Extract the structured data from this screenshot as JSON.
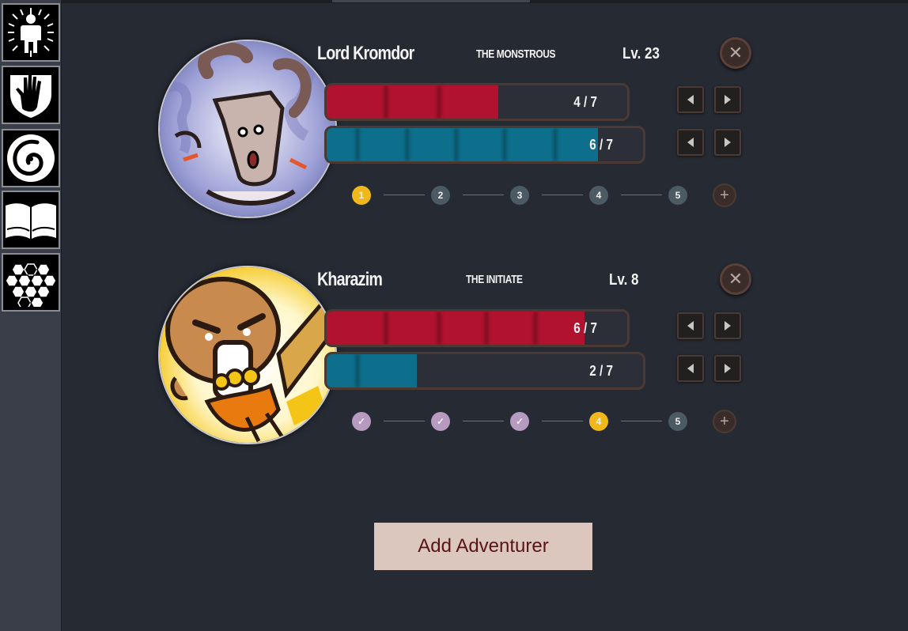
{
  "sidebar": {
    "items": [
      {
        "icon": "radiant-figure-icon"
      },
      {
        "icon": "hand-shield-icon"
      },
      {
        "icon": "spiral-icon"
      },
      {
        "icon": "open-book-icon"
      },
      {
        "icon": "hexagon-grid-icon"
      }
    ]
  },
  "adventurers": [
    {
      "name": "Lord Kromdor",
      "title": "THE MONSTROUS",
      "level": "Lv. 23",
      "health": {
        "text": "4 / 7",
        "current": 4,
        "max": 7
      },
      "mana": {
        "text": "6 / 7",
        "current": 6,
        "max": 7
      },
      "steps": [
        "1",
        "2",
        "3",
        "4",
        "5"
      ],
      "current_step": 1,
      "close_label": "✕",
      "add_step_label": "+"
    },
    {
      "name": "Kharazim",
      "title": "THE INITIATE",
      "level": "Lv. 8",
      "health": {
        "text": "6 / 7",
        "current": 6,
        "max": 7
      },
      "mana": {
        "text": "2 / 7",
        "current": 2,
        "max": 7
      },
      "steps": [
        "✓",
        "✓",
        "✓",
        "4",
        "5"
      ],
      "current_step": 4,
      "close_label": "✕",
      "add_step_label": "+"
    }
  ],
  "add_button_label": "Add Adventurer",
  "colors": {
    "health": "#b0122f",
    "mana": "#0e6f8c",
    "current_step": "#f1b81c",
    "completed_step": "#b69ac0",
    "pending_step": "#4b5a63",
    "button_bg": "#dcc7be",
    "button_text": "#5a1414"
  }
}
